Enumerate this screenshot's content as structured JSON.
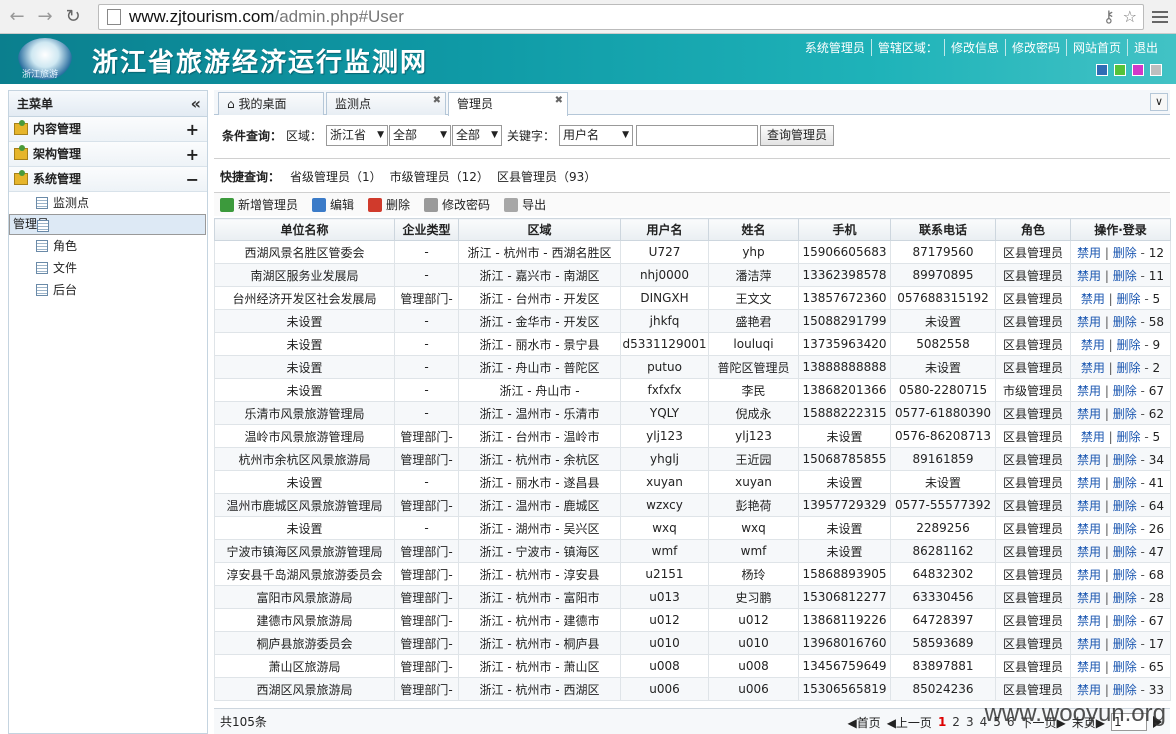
{
  "browser": {
    "url_host": "www.zjtourism.com",
    "url_path": "/admin.php#User"
  },
  "header": {
    "site_title": "浙江省旅游经济运行监测网",
    "logo_text": "浙江旅游",
    "links": [
      "系统管理员",
      "管辖区域：",
      "修改信息",
      "修改密码",
      "网站首页",
      "退出"
    ],
    "skin_colors": [
      "#2f6db5",
      "#55c23a",
      "#d238c9",
      "#bfbfbf"
    ]
  },
  "sidebar": {
    "title": "主菜单",
    "groups": [
      {
        "label": "内容管理",
        "toggle": "+"
      },
      {
        "label": "架构管理",
        "toggle": "+"
      },
      {
        "label": "系统管理",
        "toggle": "−"
      }
    ],
    "items": [
      "监测点",
      "管理员",
      "角色",
      "文件",
      "后台"
    ]
  },
  "tabs": [
    {
      "label": "我的桌面"
    },
    {
      "label": "监测点"
    },
    {
      "label": "管理员"
    }
  ],
  "filter": {
    "label": "条件查询：",
    "region_label": "区域：",
    "province": "浙江省",
    "city": "全部",
    "district": "全部",
    "keyword_label": "关键字：",
    "keyword_field": "用户名",
    "keyword_value": "",
    "search_button": "查询管理员"
  },
  "quick": {
    "label": "快捷查询：",
    "items": [
      "省级管理员（1）",
      "市级管理员（12）",
      "区县管理员（93）"
    ]
  },
  "toolbar": {
    "add": "新增管理员",
    "edit": "编辑",
    "delete": "删除",
    "password": "修改密码",
    "export": "导出"
  },
  "grid": {
    "columns": [
      "单位名称",
      "企业类型",
      "区域",
      "用户名",
      "姓名",
      "手机",
      "联系电话",
      "角色",
      "操作·登录"
    ],
    "op_disable": "禁用",
    "op_delete": "删除",
    "rows": [
      [
        "西湖风景名胜区管委会",
        "-",
        "浙江 - 杭州市 - 西湖名胜区",
        "U727",
        "yhp",
        "15906605683",
        "87179560",
        "区县管理员",
        "12"
      ],
      [
        "南湖区服务业发展局",
        "-",
        "浙江 - 嘉兴市 - 南湖区",
        "nhj0000",
        "潘洁萍",
        "13362398578",
        "89970895",
        "区县管理员",
        "11"
      ],
      [
        "台州经济开发区社会发展局",
        "管理部门-",
        "浙江 - 台州市 - 开发区",
        "DINGXH",
        "王文文",
        "13857672360",
        "057688315192",
        "区县管理员",
        "5"
      ],
      [
        "未设置",
        "-",
        "浙江 - 金华市 - 开发区",
        "jhkfq",
        "盛艳君",
        "15088291799",
        "未设置",
        "区县管理员",
        "58"
      ],
      [
        "未设置",
        "-",
        "浙江 - 丽水市 - 景宁县",
        "d5331129001",
        "louluqi",
        "13735963420",
        "5082558",
        "区县管理员",
        "9"
      ],
      [
        "未设置",
        "-",
        "浙江 - 舟山市 - 普陀区",
        "putuo",
        "普陀区管理员",
        "13888888888",
        "未设置",
        "区县管理员",
        "2"
      ],
      [
        "未设置",
        "-",
        "浙江 - 舟山市 -",
        "fxfxfx",
        "李民",
        "13868201366",
        "0580-2280715",
        "市级管理员",
        "67"
      ],
      [
        "乐清市风景旅游管理局",
        "-",
        "浙江 - 温州市 - 乐清市",
        "YQLY",
        "倪成永",
        "15888222315",
        "0577-61880390",
        "区县管理员",
        "62"
      ],
      [
        "温岭市风景旅游管理局",
        "管理部门-",
        "浙江 - 台州市 - 温岭市",
        "ylj123",
        "ylj123",
        "未设置",
        "0576-86208713",
        "区县管理员",
        "5"
      ],
      [
        "杭州市余杭区风景旅游局",
        "管理部门-",
        "浙江 - 杭州市 - 余杭区",
        "yhglj",
        "王近园",
        "15068785855",
        "89161859",
        "区县管理员",
        "34"
      ],
      [
        "未设置",
        "-",
        "浙江 - 丽水市 - 遂昌县",
        "xuyan",
        "xuyan",
        "未设置",
        "未设置",
        "区县管理员",
        "41"
      ],
      [
        "温州市鹿城区风景旅游管理局",
        "管理部门-",
        "浙江 - 温州市 - 鹿城区",
        "wzxcy",
        "彭艳荷",
        "13957729329",
        "0577-55577392",
        "区县管理员",
        "64"
      ],
      [
        "未设置",
        "-",
        "浙江 - 湖州市 - 吴兴区",
        "wxq",
        "wxq",
        "未设置",
        "2289256",
        "区县管理员",
        "26"
      ],
      [
        "宁波市镇海区风景旅游管理局",
        "管理部门-",
        "浙江 - 宁波市 - 镇海区",
        "wmf",
        "wmf",
        "未设置",
        "86281162",
        "区县管理员",
        "47"
      ],
      [
        "淳安县千岛湖风景旅游委员会",
        "管理部门-",
        "浙江 - 杭州市 - 淳安县",
        "u2151",
        "杨玲",
        "15868893905",
        "64832302",
        "区县管理员",
        "68"
      ],
      [
        "富阳市风景旅游局",
        "管理部门-",
        "浙江 - 杭州市 - 富阳市",
        "u013",
        "史习鹏",
        "15306812277",
        "63330456",
        "区县管理员",
        "28"
      ],
      [
        "建德市风景旅游局",
        "管理部门-",
        "浙江 - 杭州市 - 建德市",
        "u012",
        "u012",
        "13868119226",
        "64728397",
        "区县管理员",
        "67"
      ],
      [
        "桐庐县旅游委员会",
        "管理部门-",
        "浙江 - 杭州市 - 桐庐县",
        "u010",
        "u010",
        "13968016760",
        "58593689",
        "区县管理员",
        "17"
      ],
      [
        "萧山区旅游局",
        "管理部门-",
        "浙江 - 杭州市 - 萧山区",
        "u008",
        "u008",
        "13456759649",
        "83897881",
        "区县管理员",
        "65"
      ],
      [
        "西湖区风景旅游局",
        "管理部门-",
        "浙江 - 杭州市 - 西湖区",
        "u006",
        "u006",
        "15306565819",
        "85024236",
        "区县管理员",
        "33"
      ]
    ]
  },
  "footer": {
    "total": "共105条",
    "first": "首页",
    "prev": "上一页",
    "pages": [
      "1",
      "2",
      "3",
      "4",
      "5",
      "6"
    ],
    "current_page": "1",
    "next": "下一页",
    "last": "末页",
    "page_input": "1"
  },
  "watermark": "www.wooyun.org"
}
